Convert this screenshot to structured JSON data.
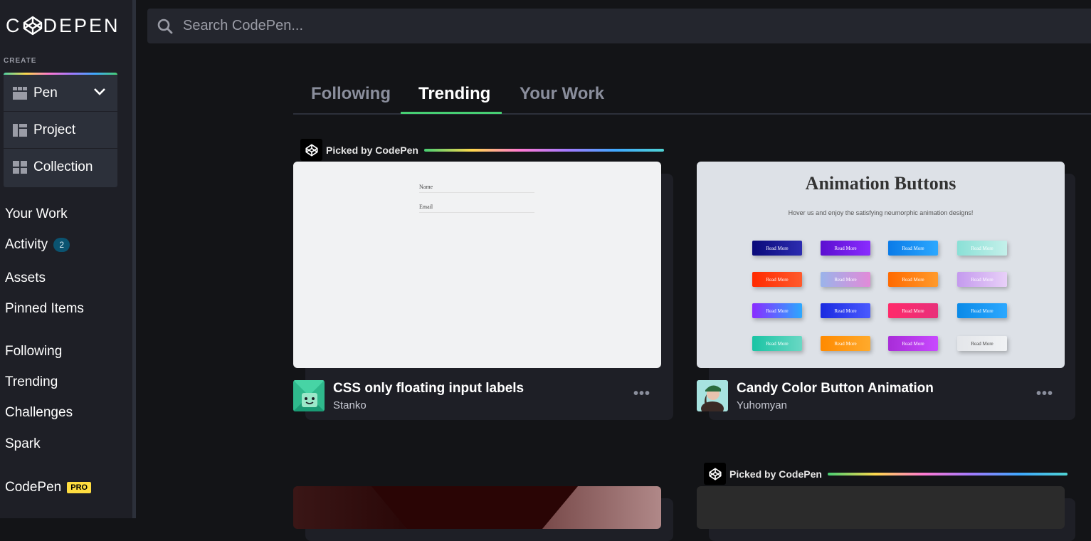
{
  "logo": {
    "text_left": "C",
    "text_right": "DEPEN"
  },
  "sidebar": {
    "create_label": "CREATE",
    "create_items": [
      {
        "label": "Pen"
      },
      {
        "label": "Project"
      },
      {
        "label": "Collection"
      }
    ],
    "nav": [
      {
        "label": "Your Work"
      },
      {
        "label": "Activity",
        "badge": "2"
      },
      {
        "label": "Assets"
      },
      {
        "label": "Pinned Items"
      },
      {
        "label": "Following"
      },
      {
        "label": "Trending"
      },
      {
        "label": "Challenges"
      },
      {
        "label": "Spark"
      },
      {
        "label": "CodePen",
        "badge": "PRO"
      }
    ]
  },
  "search": {
    "placeholder": "Search CodePen..."
  },
  "tabs": [
    {
      "label": "Following",
      "active": false
    },
    {
      "label": "Trending",
      "active": true
    },
    {
      "label": "Your Work",
      "active": false
    }
  ],
  "picked_label": "Picked by CodePen",
  "cards": [
    {
      "title": "CSS only floating input labels",
      "author": "Stanko",
      "preview": {
        "field1": "Name",
        "field2": "Email"
      }
    },
    {
      "title": "Candy Color Button Animation",
      "author": "Yuhomyan",
      "preview": {
        "heading": "Animation Buttons",
        "subheading": "Hover us and enjoy the satisfying neumorphic animation designs!",
        "button_label": "Read More"
      }
    }
  ],
  "colors": {
    "accent_green": "#47cf73",
    "sidebar_bg": "#1e1f26",
    "page_bg": "#131417",
    "badge_bg": "#0b5370",
    "pro_bg": "#ffdd40"
  }
}
